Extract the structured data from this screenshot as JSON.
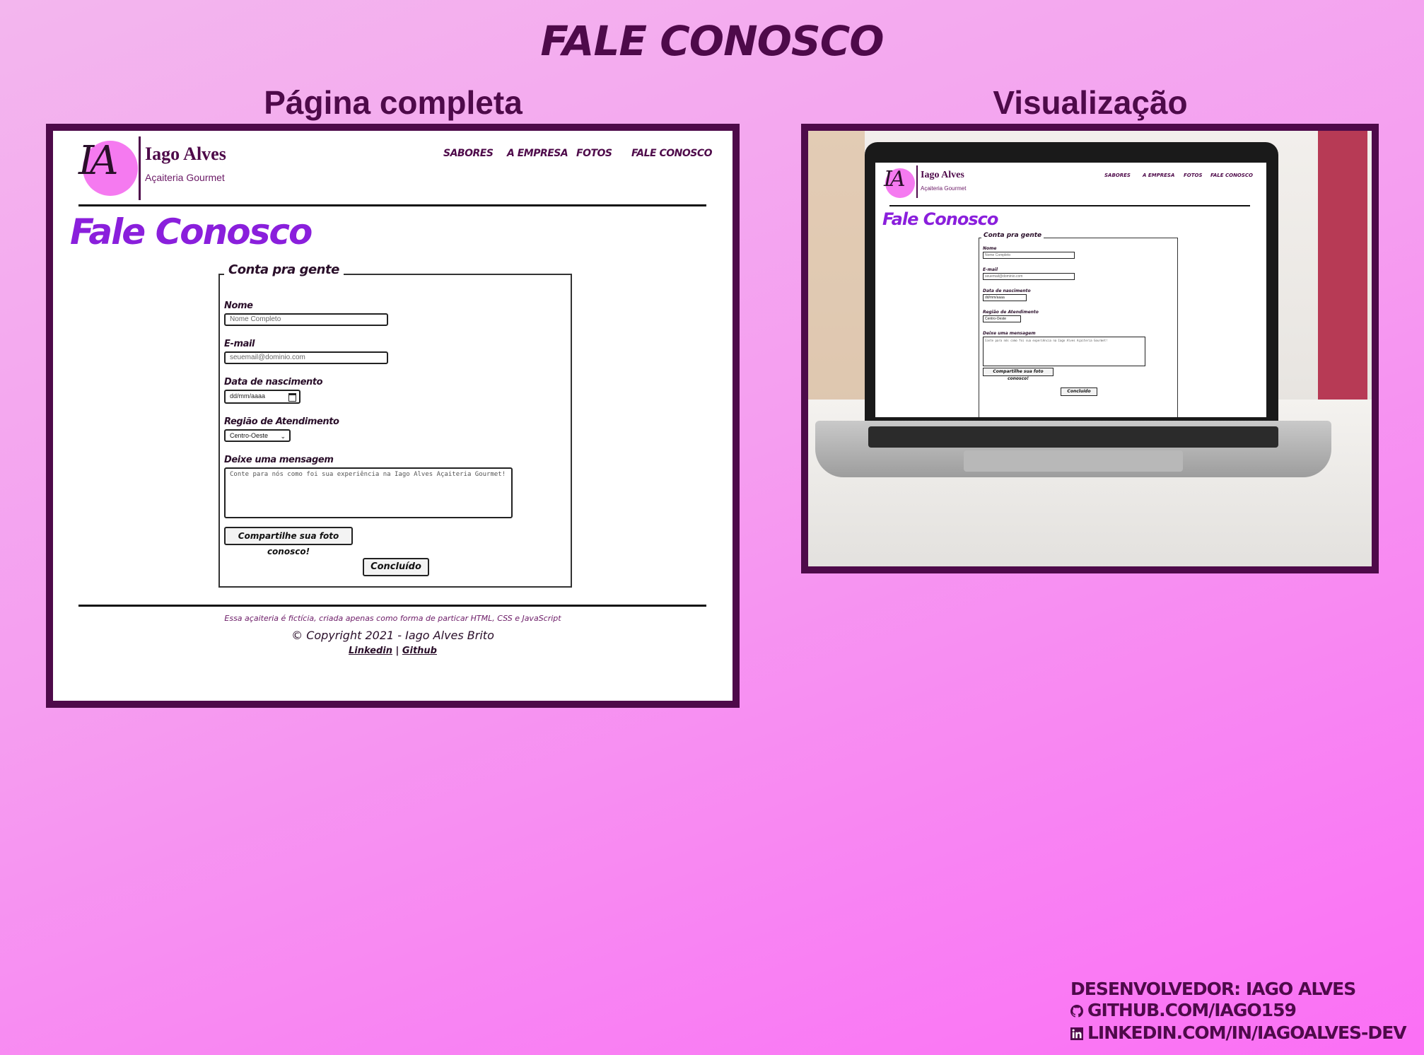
{
  "main_title": "FALE CONOSCO",
  "sections": {
    "full": "Página completa",
    "preview": "Visualização"
  },
  "site": {
    "logo_initials": "IA",
    "brand_name": "Iago Alves",
    "brand_subtitle": "Açaiteria Gourmet",
    "nav": [
      "SABORES",
      "A EMPRESA",
      "FOTOS",
      "FALE CONOSCO"
    ],
    "page_heading": "Fale Conosco",
    "form": {
      "legend": "Conta pra gente",
      "name_label": "Nome",
      "name_placeholder": "Nome Completo",
      "email_label": "E-mail",
      "email_placeholder": "seuemail@dominio.com",
      "birth_label": "Data de nascimento",
      "birth_placeholder": "dd/mm/aaaa",
      "region_label": "Região de Atendimento",
      "region_value": "Centro-Oeste",
      "message_label": "Deixe uma mensagem",
      "message_placeholder": "Conte para nós como foi sua experiência na Iago Alves Açaiteria Gourmet!",
      "photo_button": "Compartilhe sua foto conosco!",
      "submit_button": "Concluído"
    },
    "footer": {
      "note": "Essa açaiteria é fictícia, criada apenas como forma de particar HTML, CSS e JavaScript",
      "copyright": "© Copyright 2021 - Iago Alves Brito",
      "link_linkedin": "Linkedin",
      "separator": "|",
      "link_github": "Github"
    }
  },
  "credits": {
    "developer": "DESENVOLVEDOR: IAGO ALVES",
    "github": "GITHUB.COM/IAGO159",
    "linkedin": "LINKEDIN.COM/IN/IAGOALVES-DEV"
  },
  "colors": {
    "dark_purple": "#4e0a4a",
    "heading_purple": "#8a1fdc",
    "logo_pink": "#f57af0"
  }
}
